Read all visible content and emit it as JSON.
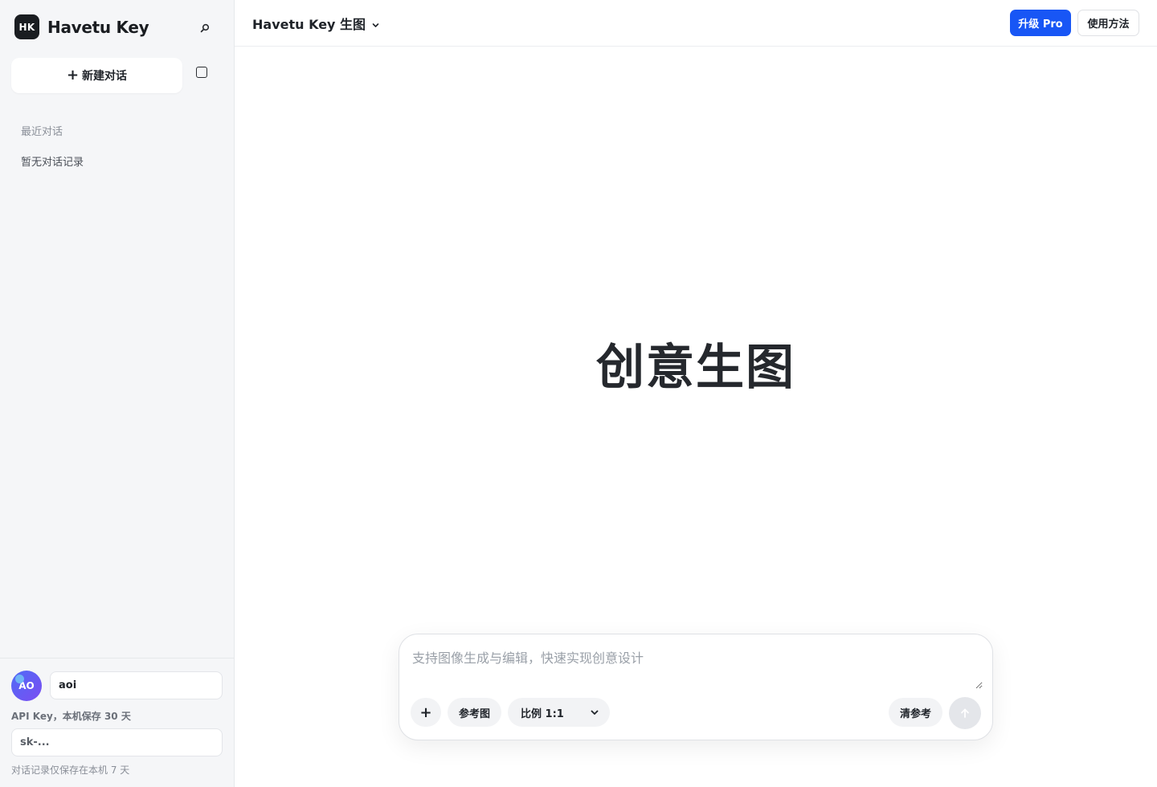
{
  "sidebar": {
    "brand": {
      "logo_text": "HK",
      "name": "Havetu Key"
    },
    "search_icon": "search-icon",
    "new_chat": {
      "icon": "+",
      "label": "新建对话"
    },
    "toggle_icon": "square-icon",
    "recent_label": "最近对话",
    "empty_label": "暂无对话记录",
    "footer": {
      "avatar_initials": "AO",
      "name_value": "aoi",
      "api_key_note": "API Key，本机保存 30 天",
      "api_key_placeholder": "sk-...",
      "history_note": "对话记录仅保存在本机 7 天"
    }
  },
  "header": {
    "title": "Havetu Key 生图",
    "upgrade_label": "升级 Pro",
    "help_label": "使用方法"
  },
  "main": {
    "hero_title": "创意生图"
  },
  "composer": {
    "placeholder": "支持图像生成与编辑，快速实现创意设计",
    "add_icon": "+",
    "reference_label": "参考图",
    "ratio_selected": "比例 1:1",
    "clear_reference_label": "清参考",
    "send_icon": "arrow-up-icon"
  },
  "colors": {
    "accent": "#1856f5",
    "sidebar_bg": "#f5f6f8",
    "avatar_gradient_start": "#4f6bf6",
    "avatar_gradient_end": "#7b4df2"
  }
}
